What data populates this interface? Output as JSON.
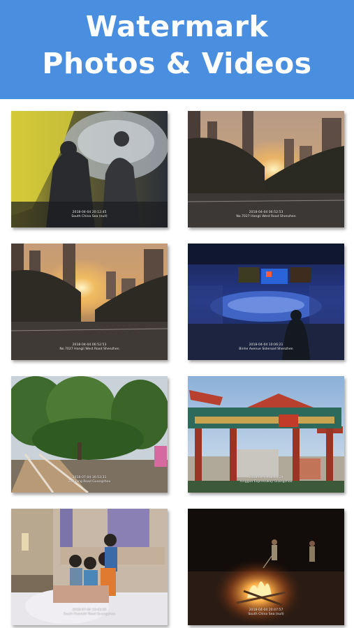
{
  "header": {
    "title_line1": "Watermark",
    "title_line2": "Photos & Videos",
    "background_color": "#4a8ee0"
  },
  "photos": [
    {
      "scene": "tent-interior",
      "timestamp": "2018-04-04 20:12:45",
      "location": "South China Sea (null)"
    },
    {
      "scene": "city-sunset",
      "timestamp": "2018-04-04 06:52:53",
      "location": "No.7027 Hongli West Road Shenzhen"
    },
    {
      "scene": "city-sunset-alt",
      "timestamp": "2018-04-04 06:52:53",
      "location": "No.7027 Hongli West Road Shenzhen"
    },
    {
      "scene": "stadium-concert",
      "timestamp": "2018-04-04 10:06:21",
      "location": "Binhe Avenue Sideroad Shenzhen"
    },
    {
      "scene": "park-trees",
      "timestamp": "2018-07-04 16:53:31",
      "location": "Zhujiang Road Guangzhou"
    },
    {
      "scene": "chinese-gate",
      "timestamp": "2018-07-04 12:14:29",
      "location": "Xingguo Expressway Guangzhou"
    },
    {
      "scene": "family-bed",
      "timestamp": "2018-07-04 19:43:50",
      "location": "South Huanshi Road Guangzhou"
    },
    {
      "scene": "campfire-night",
      "timestamp": "2018-04-04 20:47:57",
      "location": "South China Sea (null)"
    }
  ]
}
